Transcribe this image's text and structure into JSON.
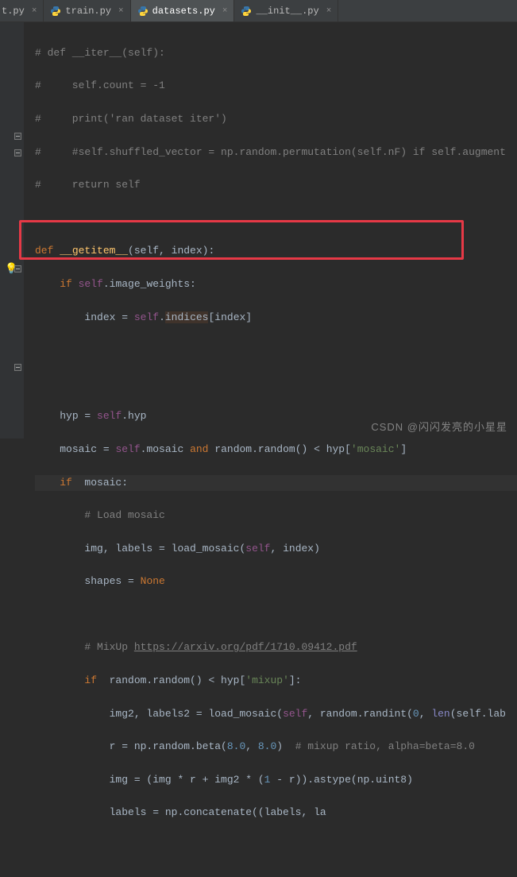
{
  "tabs": [
    {
      "name": "t.py",
      "active": false,
      "partial": true
    },
    {
      "name": "train.py",
      "active": false
    },
    {
      "name": "datasets.py",
      "active": true
    },
    {
      "name": "__init__.py",
      "active": false
    }
  ],
  "code": {
    "c1": "# def __iter__(self):",
    "c2": "#     self.count = -1",
    "c3": "#     print('ran dataset iter')",
    "c4": "#     #self.shuffled_vector = np.random.permutation(self.nF) if self.augment",
    "c5": "#     return self",
    "def": "def ",
    "getitem": "__getitem__",
    "getitem_args": "(self, index):",
    "if": "if ",
    "self": "self",
    "dot_image_weights": ".image_weights:",
    "index_eq": "index = ",
    "dot_indices": ".",
    "indices": "indices",
    "idx_bracket": "[index]",
    "hyp_eq": "hyp = ",
    "dot_hyp": ".hyp",
    "mosaic_eq": "mosaic = ",
    "dot_mosaic": ".mosaic ",
    "and": "and",
    "random_random": " random.random() < hyp[",
    "mosaic_str": "'mosaic'",
    "close_br": "]",
    "if_mosaic": " mosaic:",
    "load_mosaic_c": "# Load mosaic",
    "img_labels": "img, labels = load_mosaic(",
    "comma_idx": ", index)",
    "shapes_eq": "shapes = ",
    "none": "None",
    "mixup_c1": "# MixUp ",
    "mixup_url": "https://arxiv.org/pdf/1710.09412.pdf",
    "random_lt": " random.random() < hyp[",
    "mixup_str": "'mixup'",
    "close_br2": "]:",
    "img2_labels2": "img2, labels2 = load_mosaic(",
    "randint": ", random.randint(",
    "zero": "0",
    "len": "len",
    "self_lab": "(self.lab",
    "r_eq": "r = np.random.beta(",
    "eight1": "8.0",
    "comma": ", ",
    "eight2": "8.0",
    "beta_close": ")  ",
    "mixup_ratio_c": "# mixup ratio, alpha=beta=8.0",
    "img_eq": "img = (img * r + img2 * (",
    "one": "1",
    "minus_r": " - r)).astype(np.uint8)",
    "labels_eq": "labels = np.concatenate((labels, la"
  },
  "watermark": "CSDN @闪闪发亮的小星星"
}
